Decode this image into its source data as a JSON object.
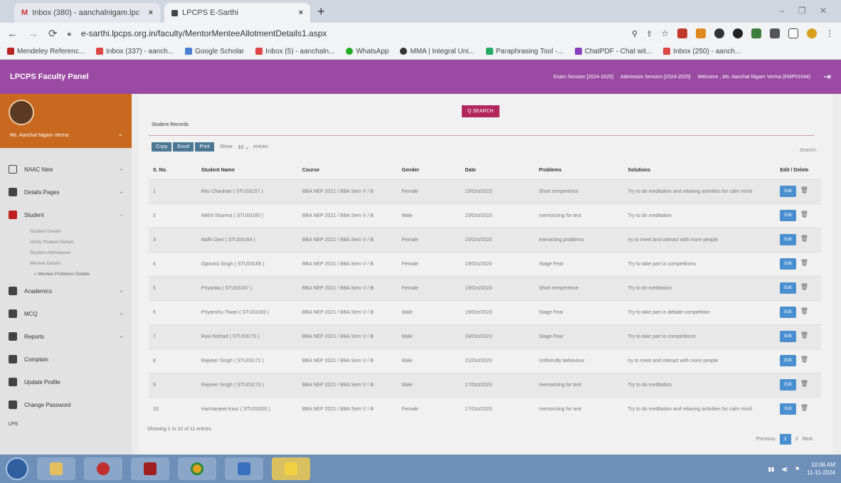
{
  "browser": {
    "tabs": [
      {
        "label": "Inbox (380) - aanchalnigam.lpc",
        "icon": "gmail-icon"
      },
      {
        "label": "LPCPS E-Sarthi",
        "icon": "site-icon"
      }
    ],
    "url": "e-sarthi.lpcps.org.in/faculty/MentorMenteeAllotmentDetails1.aspx",
    "bookmarks": [
      "Mendeley Referenc...",
      "Inbox (337) - aanch...",
      "Google Scholar",
      "Inbox (5) - aanchaln...",
      "WhatsApp",
      "MMA | Integral Uni...",
      "Paraphrasing Tool -...",
      "ChatPDF - Chat wit...",
      "Inbox (250) - aanch..."
    ]
  },
  "header": {
    "brand": "LPCPS Faculty Panel",
    "exam_session": "Exam Session [2024-2025]",
    "admission_session": "Admission Session [2024-2025]",
    "welcome": "Welcome , Ms. Aanchal Nigam Verma (EMP01044)"
  },
  "sidebar": {
    "profile_name": "Ms. Aanchal Nigam Verma",
    "items": [
      {
        "label": "NAAC New"
      },
      {
        "label": "Details Pages"
      },
      {
        "label": "Student"
      },
      {
        "label": "Academics"
      },
      {
        "label": "MCQ"
      },
      {
        "label": "Reports"
      },
      {
        "label": "Complain"
      },
      {
        "label": "Update Profile"
      },
      {
        "label": "Change Password"
      }
    ],
    "student_sub": [
      "Student Details",
      "Verify Student Details",
      "Student Attendance",
      "Mentee Details",
      "» Mentee Problems Details"
    ],
    "footer": "LPS"
  },
  "main": {
    "search_label": "Q SEARCH",
    "section_title": "Student Records",
    "tools": [
      "Copy",
      "Excel",
      "Print"
    ],
    "show_label": "Show",
    "show_value": "10",
    "entries_label": "entries",
    "search_field_label": "Search:",
    "columns": [
      "S. No.",
      "Student Name",
      "Course",
      "Gender",
      "Date",
      "Problems",
      "Solutions",
      "Edit / Delete"
    ],
    "rows": [
      {
        "sno": "1",
        "name": "Ritu Chauhan ( STU03157 )",
        "course": "BBA NEP 2021 / BBA Sem V / B",
        "gender": "Female",
        "date": "15/Oct/2023",
        "problem": "Short temperence",
        "solution": "Try to do meditation and relaxing activities for calm mind"
      },
      {
        "sno": "2",
        "name": "Nikhil Sharma ( STU03160 )",
        "course": "BBA NEP 2021 / BBA Sem V / B",
        "gender": "Male",
        "date": "23/Oct/2023",
        "problem": "memorizing for test",
        "solution": "Try to do meditation"
      },
      {
        "sno": "3",
        "name": "Nidhi Devi ( STU03164 )",
        "course": "BBA NEP 2021 / BBA Sem V / B",
        "gender": "Female",
        "date": "23/Oct/2023",
        "problem": "interacting problems",
        "solution": "try to meet and interact with more people"
      },
      {
        "sno": "4",
        "name": "Ojasvini Singh ( STU03166 )",
        "course": "BBA NEP 2021 / BBA Sem V / B",
        "gender": "Female",
        "date": "19/Oct/2023",
        "problem": "Stage Fear",
        "solution": "Try to take part in competitions"
      },
      {
        "sno": "5",
        "name": "Priyanka ( STU03167 )",
        "course": "BBA NEP 2021 / BBA Sem V / B",
        "gender": "Female",
        "date": "19/Oct/2023",
        "problem": "Short temperence",
        "solution": "Try to do meditation"
      },
      {
        "sno": "6",
        "name": "Priyanshu Tiwari ( STU03169 )",
        "course": "BBA NEP 2021 / BBA Sem V / B",
        "gender": "Male",
        "date": "19/Oct/2023",
        "problem": "Stage Fear",
        "solution": "Try to take part in debate competition"
      },
      {
        "sno": "7",
        "name": "Ravi Nishad ( STU03170 )",
        "course": "BBA NEP 2021 / BBA Sem V / B",
        "gender": "Male",
        "date": "24/Oct/2023",
        "problem": "Stage Fear",
        "solution": "Try to take part in competitions"
      },
      {
        "sno": "8",
        "name": "Rajveer Singh ( STU03172 )",
        "course": "BBA NEP 2021 / BBA Sem V / B",
        "gender": "Male",
        "date": "21/Oct/2023",
        "problem": "Unfriendly behaviour",
        "solution": "try to meet and interact with more people"
      },
      {
        "sno": "9",
        "name": "Rajveer Singh ( STU03173 )",
        "course": "BBA NEP 2021 / BBA Sem V / B",
        "gender": "Male",
        "date": "17/Oct/2023",
        "problem": "memorizing for test",
        "solution": "Try to do meditation"
      },
      {
        "sno": "10",
        "name": "Harmanjeet Kaur ( STU03200 )",
        "course": "BBA NEP 2021 / BBA Sem V / B",
        "gender": "Female",
        "date": "17/Oct/2023",
        "problem": "memorizing for test",
        "solution": "Try to do meditation and relaxing activities for calm mind"
      }
    ],
    "edit_label": "Edit",
    "info": "Showing 1 to 10 of 11 entries",
    "pager": {
      "prev": "Previous",
      "pages": [
        "1",
        "2"
      ],
      "next": "Next"
    }
  },
  "taskbar": {
    "time": "10:06 AM",
    "date": "11-11-2024"
  }
}
